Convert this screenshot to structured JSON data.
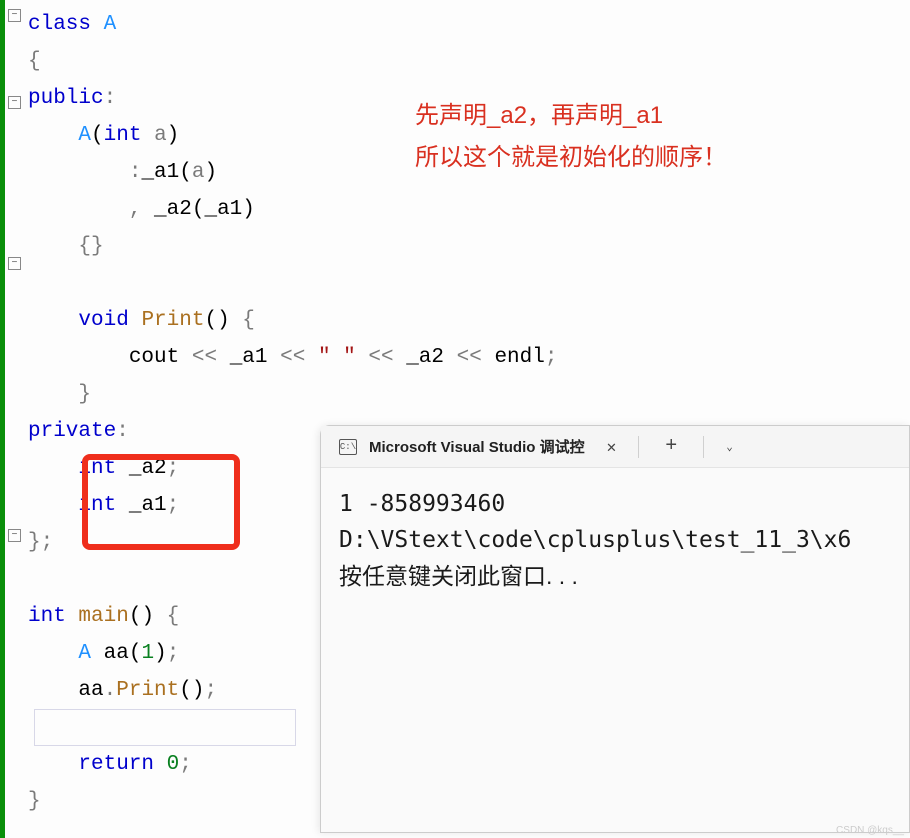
{
  "code": {
    "l1_class": "class",
    "l1_name": "A",
    "l2_brace": "{",
    "l3_public": "public",
    "l3_colon": ":",
    "l4_ctor": "A",
    "l4_int": "int",
    "l4_param": "a",
    "l5_init1_colon": ":",
    "l5_init1_mem": "_a1",
    "l5_init1_arg": "a",
    "l6_init2_comma": ",",
    "l6_init2_mem": "_a2",
    "l6_init2_arg": "_a1",
    "l7_body": "{}",
    "l9_void": "void",
    "l9_func": "Print",
    "l10_cout": "cout",
    "l10_a1": "_a1",
    "l10_str": "\" \"",
    "l10_a2": "_a2",
    "l10_endl": "endl",
    "l12_private": "private",
    "l13_int": "int",
    "l13_var": "_a2",
    "l14_int": "int",
    "l14_var": "_a1",
    "l17_int": "int",
    "l17_main": "main",
    "l18_type": "A",
    "l18_var": "aa",
    "l18_arg": "1",
    "l19_obj": "aa",
    "l19_dot": ".",
    "l19_call": "Print",
    "l21_return": "return",
    "l21_val": "0"
  },
  "annotation": {
    "line1": "先声明_a2，再声明_a1",
    "line2": "所以这个就是初始化的顺序！"
  },
  "console": {
    "title": "Microsoft Visual Studio 调试控",
    "icon_text": "C:\\",
    "output_line1": "1 -858993460",
    "output_line2": "",
    "output_line3": "D:\\VStext\\code\\cplusplus\\test_11_3\\x6",
    "output_line4": "按任意键关闭此窗口. . ."
  },
  "watermark": "CSDN @kqs__"
}
